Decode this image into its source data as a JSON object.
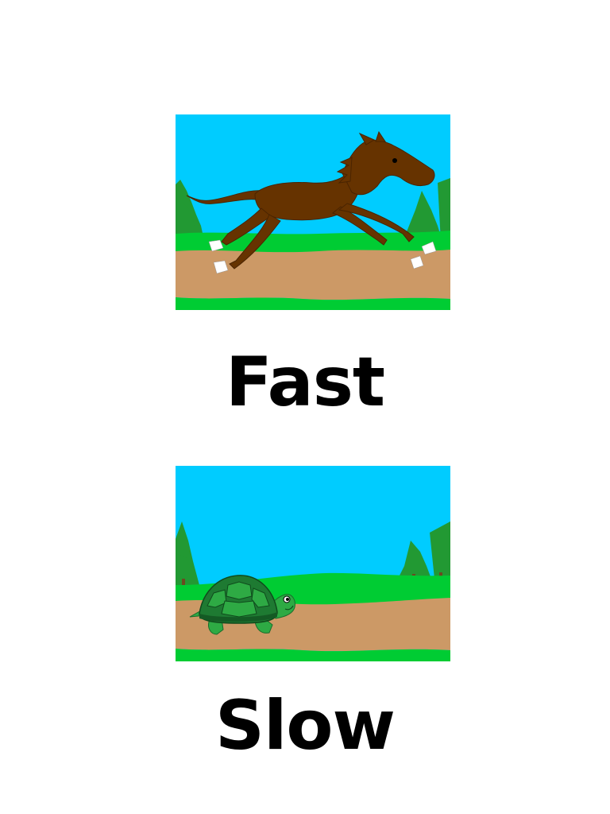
{
  "cards": [
    {
      "id": "fast",
      "label": "Fast",
      "illustration": "galloping-horse",
      "colors": {
        "sky": "#00ccff",
        "grass": "#00cc33",
        "path": "#cc9966",
        "animal": "#663300",
        "hooves": "#ffffff",
        "trees": "#229933"
      }
    },
    {
      "id": "slow",
      "label": "Slow",
      "illustration": "walking-turtle",
      "colors": {
        "sky": "#00ccff",
        "grass": "#00cc33",
        "path": "#cc9966",
        "shell": "#1e7a32",
        "body": "#2eaa44",
        "trees": "#229933"
      }
    }
  ]
}
